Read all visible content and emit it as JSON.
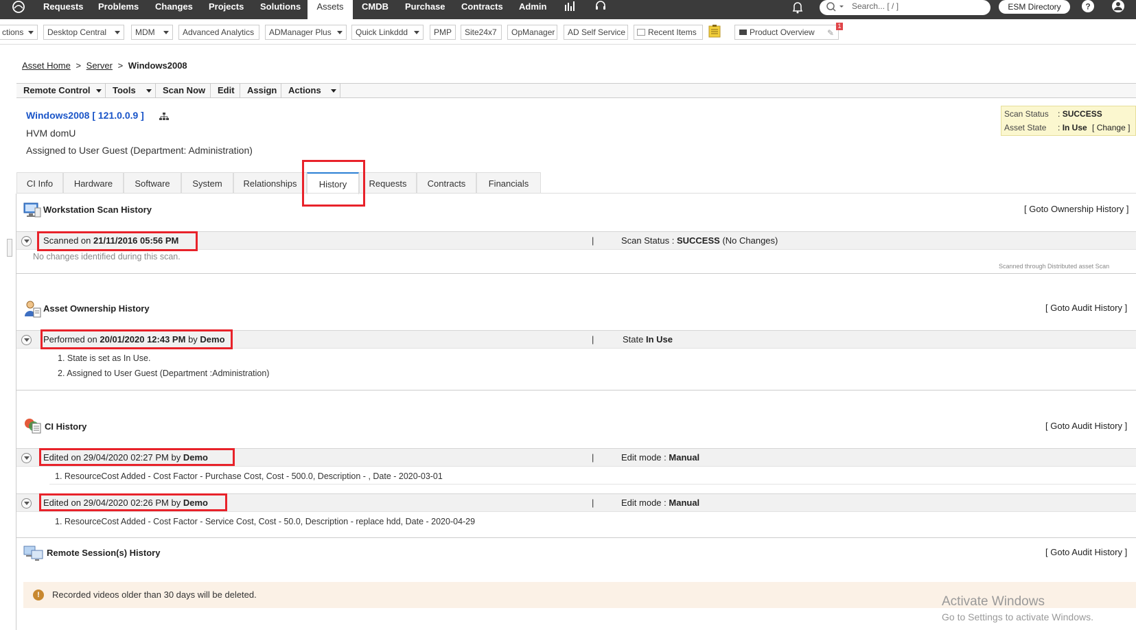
{
  "topnav": {
    "items": [
      "Requests",
      "Problems",
      "Changes",
      "Projects",
      "Solutions",
      "Assets",
      "CMDB",
      "Purchase",
      "Contracts",
      "Admin"
    ],
    "active": "Assets",
    "search_placeholder": "Search... [ / ]",
    "directory_button": "ESM Directory",
    "colors": {
      "bar": "#3b3b3b",
      "accent": "#2a7fd4",
      "highlight": "#e8222a"
    }
  },
  "shortcuts": {
    "items": [
      "ctions",
      "Desktop Central",
      "MDM",
      "Advanced Analytics",
      "ADManager Plus",
      "Quick Linkddd",
      "PMP",
      "Site24x7",
      "OpManager",
      "AD Self Service",
      "Recent Items",
      "Product Overview"
    ],
    "notification_count": "1"
  },
  "breadcrumb": {
    "home": "Asset Home",
    "sep1": ">",
    "server": "Server",
    "sep2": ">",
    "current": "Windows2008"
  },
  "actions": [
    "Remote Control",
    "Tools",
    "Scan Now",
    "Edit",
    "Assign",
    "Actions"
  ],
  "asset": {
    "title": "Windows2008 [ 121.0.0.9 ]",
    "model": "HVM domU",
    "assigned": "Assigned to User Guest (Department: Administration)"
  },
  "status": {
    "scan_label": "Scan Status",
    "scan_sep": ":",
    "scan_value": "SUCCESS",
    "state_label": "Asset State",
    "state_sep": ":",
    "state_value": "In Use",
    "change_link": "[ Change ]"
  },
  "tabs": [
    "CI Info",
    "Hardware",
    "Software",
    "System",
    "Relationships",
    "History",
    "Requests",
    "Contracts",
    "Financials"
  ],
  "active_tab": "History",
  "scan_history": {
    "title": "Workstation Scan History",
    "goto": "[ Goto Ownership History ]",
    "entry_prefix": "Scanned on",
    "entry_date": "21/11/2016 05:56 PM",
    "divider": "|",
    "status_prefix": "Scan Status :",
    "status_value": "SUCCESS",
    "status_suffix": "(No Changes)",
    "detail": "No changes identified during this scan.",
    "footnote": "Scanned through Distributed asset Scan"
  },
  "ownership_history": {
    "title": "Asset Ownership History",
    "goto": "[ Goto Audit History ]",
    "entry_prefix": "Performed on",
    "entry_date": "20/01/2020 12:43 PM",
    "entry_by": "by",
    "entry_user": "Demo",
    "divider": "|",
    "state_prefix": "State",
    "state_value": "In Use",
    "details": [
      "1.  State is set as In Use.",
      "2.  Assigned to User Guest (Department :Administration)"
    ]
  },
  "ci_history": {
    "title": "CI History",
    "goto": "[ Goto Audit History ]",
    "entries": [
      {
        "prefix": "Edited on 29/04/2020 02:27 PM  by",
        "user": "Demo",
        "divider": "|",
        "mode_prefix": "Edit mode :",
        "mode_value": "Manual",
        "detail": "1.  ResourceCost Added - Cost Factor - Purchase Cost, Cost - 500.0, Description - , Date - 2020-03-01"
      },
      {
        "prefix": "Edited on 29/04/2020 02:26 PM  by",
        "user": "Demo",
        "divider": "|",
        "mode_prefix": "Edit mode :",
        "mode_value": "Manual",
        "detail": "1.  ResourceCost Added - Cost Factor - Service Cost, Cost - 50.0, Description - replace hdd, Date - 2020-04-29"
      }
    ]
  },
  "remote_history": {
    "title": "Remote Session(s) History",
    "goto": "[ Goto Audit History ]",
    "notice": "Recorded videos older than 30 days will be deleted.",
    "notice_icon": "!"
  },
  "watermark": {
    "line1": "Activate Windows",
    "line2": "Go to Settings to activate Windows."
  }
}
